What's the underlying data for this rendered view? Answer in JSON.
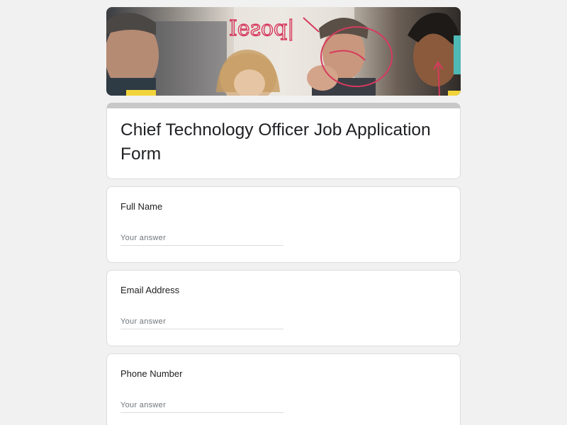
{
  "banner": {
    "image_description_icon": "team-whiteboard-photo",
    "handwritten_text": "Ieƨoq|"
  },
  "form": {
    "title": "Chief Technology Officer Job Application Form",
    "accent_color": "#c8c8c8",
    "questions": [
      {
        "label": "Full Name",
        "placeholder": "Your answer"
      },
      {
        "label": "Email Address",
        "placeholder": "Your answer"
      },
      {
        "label": "Phone Number",
        "placeholder": "Your answer"
      }
    ]
  }
}
